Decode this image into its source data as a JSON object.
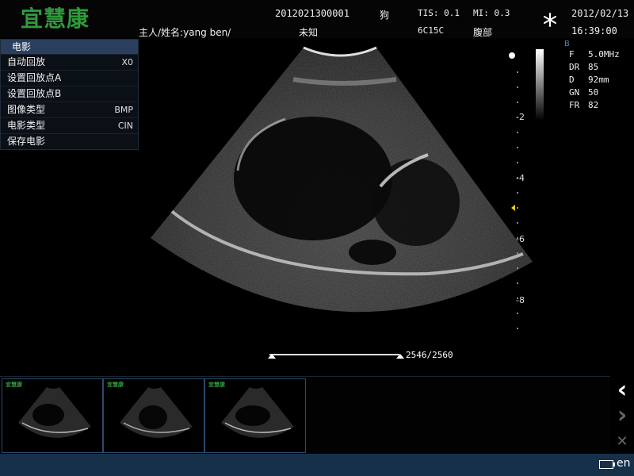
{
  "header": {
    "logo": "宜慧康",
    "patient_id": "2012021300001",
    "owner_label": "主人/姓名:yang ben/",
    "species": "狗",
    "sex": "未知",
    "tis": "TIS: 0.1",
    "mi": "MI: 0.3",
    "probe": "6C15C",
    "exam": "腹部",
    "date": "2012/02/13",
    "time": "16:39:00",
    "freeze_icon": "snowflake-icon"
  },
  "cine_menu": {
    "title": "电影",
    "items": [
      {
        "label": "自动回放",
        "value": "X0"
      },
      {
        "label": "设置回放点A",
        "value": ""
      },
      {
        "label": "设置回放点B",
        "value": ""
      },
      {
        "label": "图像类型",
        "value": "BMP"
      },
      {
        "label": "电影类型",
        "value": "CIN"
      },
      {
        "label": "保存电影",
        "value": ""
      }
    ]
  },
  "depth_scale": {
    "labels": [
      "-2",
      "-4",
      "-6",
      "-8"
    ]
  },
  "params": {
    "mode": "B",
    "rows": [
      {
        "k": "F",
        "v": "5.0MHz"
      },
      {
        "k": "DR",
        "v": "85"
      },
      {
        "k": "D",
        "v": "92mm"
      },
      {
        "k": "GN",
        "v": "50"
      },
      {
        "k": "FR",
        "v": "82"
      }
    ]
  },
  "cine_progress": {
    "text": "2546/2560"
  },
  "thumbnails": {
    "logo": "宜慧康",
    "count": 3
  },
  "nav": {
    "prev": "‹",
    "next": "›",
    "close": "✕"
  },
  "status": {
    "language": "en"
  }
}
